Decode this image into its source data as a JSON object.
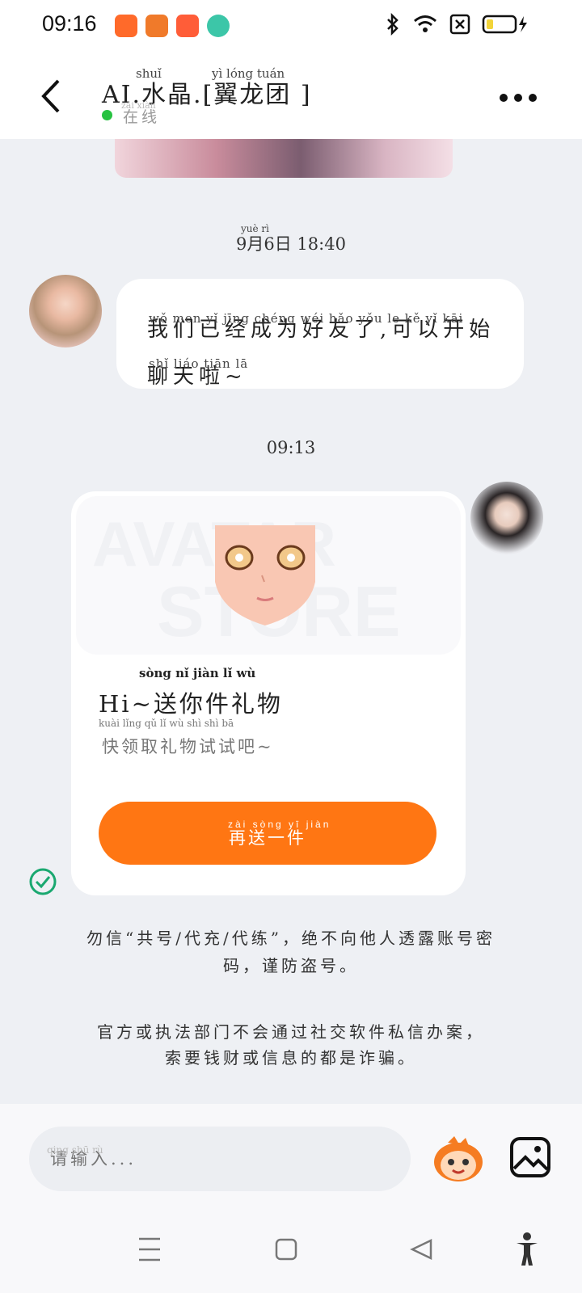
{
  "status_bar": {
    "time": "09:16"
  },
  "header": {
    "title": "AI.水晶.[翼龙团 ]",
    "title_pinyin_1": "shuǐ",
    "title_pinyin_2": "yì lóng tuán",
    "status": "在线",
    "status_pinyin": "zài xiàn"
  },
  "chat": {
    "timestamp_1": "9月6日 18:40",
    "timestamp_1_pinyin": "yuè rì",
    "friend_message": "我们已经成为好友了,可以开始聊天啦~",
    "friend_message_pinyin_1": "wǒ men yǐ jīng chéng wéi hǎo yǒu le kě yǐ kāi",
    "friend_message_pinyin_2": "shǐ liáo tiān lā",
    "timestamp_2": "09:13",
    "gift_card": {
      "watermark_1": "AVATAR",
      "watermark_2": "STORE",
      "title": "Hi~送你件礼物",
      "title_pinyin": "sòng nǐ jiàn lǐ wù",
      "subtitle": "快领取礼物试试吧~",
      "subtitle_pinyin": "kuài lǐng qǔ lǐ wù shì shì bā",
      "button_label": "再送一件",
      "button_pinyin": "zài sòng yī jiàn"
    },
    "notice_1_line_1": "勿信“共号/代充/代练”，绝不向他人透露账号密",
    "notice_1_line_2": "码，谨防盗号。",
    "notice_2_line_1": "官方或执法部门不会通过社交软件私信办案，",
    "notice_2_line_2": "索要钱财或信息的都是诈骗。"
  },
  "input": {
    "placeholder": "请输入...",
    "placeholder_pinyin": "qing shū rù"
  },
  "colors": {
    "accent": "#ff7613",
    "online": "#27c241",
    "check": "#1aa870"
  }
}
